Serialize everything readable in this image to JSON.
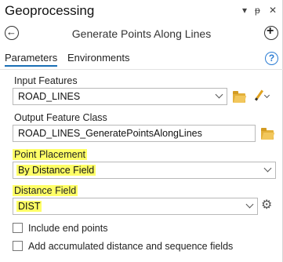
{
  "window": {
    "title": "Geoprocessing",
    "controls": [
      "▾",
      "ᵽ",
      "✕"
    ]
  },
  "header": {
    "tool_title": "Generate Points Along Lines",
    "back_glyph": "←",
    "add_glyph": "+"
  },
  "tabs": [
    {
      "label": "Parameters",
      "active": true
    },
    {
      "label": "Environments",
      "active": false
    }
  ],
  "help_glyph": "?",
  "params": {
    "input_features": {
      "label": "Input Features",
      "value": "ROAD_LINES"
    },
    "output_feature_class": {
      "label": "Output Feature Class",
      "value": "ROAD_LINES_GeneratePointsAlongLines"
    },
    "point_placement": {
      "label": "Point Placement",
      "value": "By Distance Field",
      "highlighted": true
    },
    "distance_field": {
      "label": "Distance Field",
      "value": "DIST",
      "highlighted": true
    }
  },
  "checkboxes": [
    {
      "label": "Include end points",
      "checked": false
    },
    {
      "label": "Add accumulated distance and sequence fields",
      "checked": false
    }
  ],
  "colors": {
    "highlight": "#ffff66",
    "accent": "#1a6fb5",
    "help": "#2b7cd3"
  },
  "icons": [
    "back-arrow-icon",
    "add-icon",
    "help-icon",
    "folder-icon",
    "pencil-icon",
    "gear-icon",
    "chevron-down-icon"
  ]
}
